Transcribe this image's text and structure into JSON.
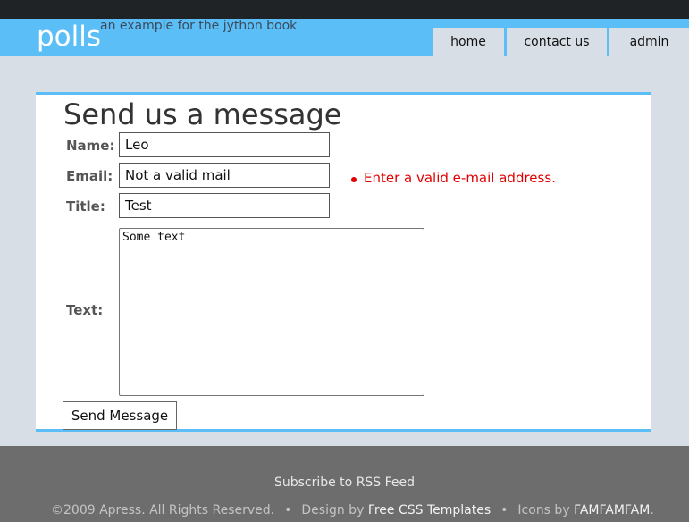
{
  "header": {
    "logo": "polls",
    "tagline": "an example for the jython book",
    "nav": [
      "home",
      "contact us",
      "admin"
    ]
  },
  "form": {
    "title": "Send us a message",
    "name_label": "Name:",
    "name_value": "Leo",
    "email_label": "Email:",
    "email_value": "Not a valid mail",
    "email_error": "Enter a valid e-mail address.",
    "title_label": "Title:",
    "title_value": "Test",
    "text_label": "Text:",
    "text_value": "Some text",
    "submit_label": "Send Message"
  },
  "footer": {
    "rss": "Subscribe to RSS Feed",
    "copyright": "©2009 Apress. All Rights Reserved.",
    "sep": "•",
    "design_prefix": "Design by",
    "design_link": "Free CSS Templates",
    "icons_prefix": "Icons by",
    "icons_link": "FAMFAMFAM",
    "period": "."
  },
  "colors": {
    "accent": "#5cbef6",
    "error": "#e00000",
    "topbar": "#1f2326",
    "footer": "#6d6d6d"
  }
}
